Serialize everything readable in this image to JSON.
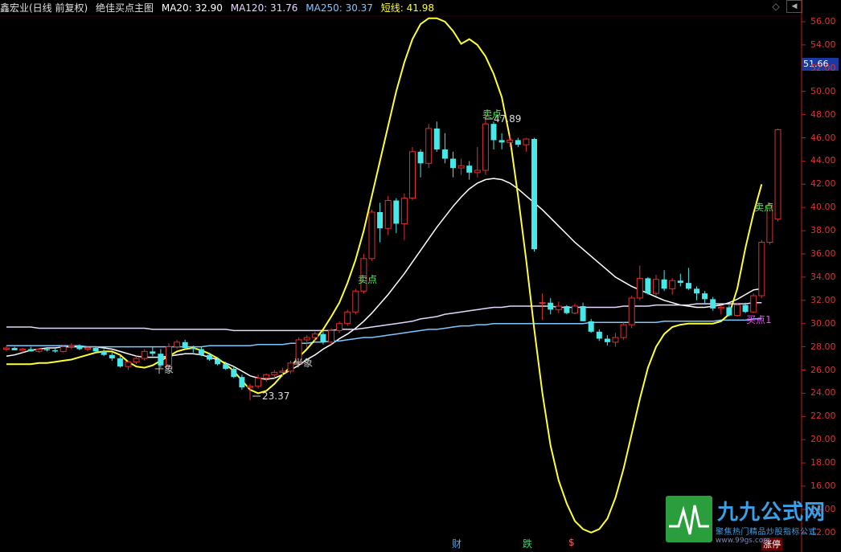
{
  "header": {
    "stock": "鑫宏业(日线 前复权)",
    "indicator": "绝佳买点主图",
    "ma20": "MA20: 32.90",
    "ma120": "MA120: 31.76",
    "ma250": "MA250: 30.37",
    "short_line": "短线: 41.98"
  },
  "price_flag": "51.66",
  "y_axis": [
    "56.00",
    "54.00",
    "52.00",
    "50.00",
    "48.00",
    "46.00",
    "44.00",
    "42.00",
    "40.00",
    "38.00",
    "36.00",
    "34.00",
    "32.00",
    "30.00",
    "28.00",
    "26.00",
    "24.00",
    "22.00",
    "20.00",
    "18.00",
    "16.00",
    "14.00",
    "12.00"
  ],
  "annotations": {
    "high_label": "47.89",
    "low_label": "23.37",
    "sell_1": "卖点",
    "sell_2": "卖点",
    "buy_1": "卖点",
    "elephant_1": "十象",
    "elephant_2": "半象",
    "buy_marker": "买点1"
  },
  "bottom_markers": {
    "cai": "财",
    "die": "跌",
    "dollar": "$",
    "zhangting": "涨停"
  },
  "logo": {
    "title": "九九公式网",
    "subtitle": "聚焦热门精品炒股指标公式",
    "url": "www.99gs.com"
  },
  "colors": {
    "up": "#e03030",
    "down": "#48e8e8",
    "ma20": "#ffffff",
    "ma120": "#e6d8ff",
    "ma250": "#7ec8ff",
    "short": "#ffff33",
    "axis": "#c02020"
  },
  "chart_data": {
    "type": "candlestick",
    "ylim": [
      12,
      57
    ],
    "candles": [
      [
        27.8,
        28.1,
        27.6,
        27.9
      ],
      [
        27.9,
        28.0,
        27.7,
        27.7
      ],
      [
        27.7,
        27.9,
        27.5,
        27.8
      ],
      [
        27.8,
        28.0,
        27.6,
        27.6
      ],
      [
        27.6,
        27.9,
        27.5,
        27.8
      ],
      [
        27.8,
        27.9,
        27.6,
        27.7
      ],
      [
        27.7,
        27.9,
        27.5,
        27.6
      ],
      [
        27.6,
        28.1,
        27.5,
        28.0
      ],
      [
        28.0,
        28.3,
        27.8,
        28.1
      ],
      [
        28.1,
        28.2,
        27.7,
        27.8
      ],
      [
        27.8,
        28.0,
        27.6,
        27.9
      ],
      [
        27.9,
        28.0,
        27.5,
        27.6
      ],
      [
        27.6,
        27.8,
        27.2,
        27.3
      ],
      [
        27.3,
        27.5,
        26.8,
        27.0
      ],
      [
        27.0,
        27.2,
        26.2,
        26.3
      ],
      [
        26.3,
        26.8,
        26.0,
        26.7
      ],
      [
        26.7,
        27.2,
        26.5,
        27.0
      ],
      [
        27.0,
        27.8,
        26.8,
        27.6
      ],
      [
        27.6,
        28.0,
        27.2,
        27.4
      ],
      [
        27.4,
        27.8,
        26.2,
        26.4
      ],
      [
        26.4,
        28.3,
        26.2,
        28.0
      ],
      [
        28.0,
        28.6,
        27.8,
        28.4
      ],
      [
        28.4,
        28.6,
        27.8,
        27.9
      ],
      [
        27.9,
        28.1,
        27.5,
        27.8
      ],
      [
        27.8,
        28.0,
        27.2,
        27.3
      ],
      [
        27.3,
        27.5,
        26.8,
        26.9
      ],
      [
        26.9,
        27.1,
        26.4,
        26.5
      ],
      [
        26.5,
        26.7,
        26.0,
        26.1
      ],
      [
        26.1,
        26.3,
        25.3,
        25.4
      ],
      [
        25.4,
        25.6,
        24.3,
        24.5
      ],
      [
        24.5,
        24.8,
        23.4,
        24.6
      ],
      [
        24.6,
        25.6,
        24.4,
        25.3
      ],
      [
        25.3,
        25.7,
        25.0,
        25.6
      ],
      [
        25.6,
        26.0,
        25.3,
        25.8
      ],
      [
        25.8,
        26.2,
        25.4,
        25.9
      ],
      [
        25.9,
        26.8,
        25.7,
        26.6
      ],
      [
        26.6,
        28.8,
        26.4,
        28.6
      ],
      [
        28.6,
        29.0,
        27.9,
        28.8
      ],
      [
        28.8,
        29.3,
        28.4,
        29.1
      ],
      [
        29.1,
        29.4,
        28.2,
        28.4
      ],
      [
        28.4,
        29.6,
        28.2,
        29.4
      ],
      [
        29.4,
        30.2,
        29.2,
        30.0
      ],
      [
        30.0,
        31.2,
        29.8,
        31.0
      ],
      [
        31.0,
        33.0,
        30.8,
        32.8
      ],
      [
        32.8,
        36.0,
        32.6,
        35.6
      ],
      [
        35.6,
        39.8,
        35.4,
        39.6
      ],
      [
        39.6,
        40.4,
        37.0,
        38.2
      ],
      [
        38.2,
        41.0,
        37.6,
        40.6
      ],
      [
        40.6,
        40.8,
        37.8,
        38.6
      ],
      [
        38.6,
        41.2,
        37.2,
        40.8
      ],
      [
        40.8,
        45.2,
        40.6,
        44.8
      ],
      [
        44.8,
        45.0,
        42.6,
        43.8
      ],
      [
        43.8,
        47.2,
        43.4,
        46.8
      ],
      [
        46.8,
        47.4,
        44.8,
        45.0
      ],
      [
        45.0,
        46.4,
        43.8,
        44.2
      ],
      [
        44.2,
        44.8,
        42.6,
        43.4
      ],
      [
        43.4,
        44.2,
        42.8,
        43.6
      ],
      [
        43.6,
        44.0,
        42.4,
        43.0
      ],
      [
        43.0,
        45.2,
        42.6,
        43.2
      ],
      [
        43.2,
        47.9,
        42.8,
        47.2
      ],
      [
        47.2,
        47.4,
        45.0,
        45.8
      ],
      [
        45.8,
        46.4,
        45.0,
        45.6
      ],
      [
        45.6,
        46.2,
        45.2,
        45.8
      ],
      [
        45.8,
        46.0,
        45.2,
        45.4
      ],
      [
        45.4,
        46.0,
        44.8,
        45.9
      ],
      [
        45.9,
        46.0,
        36.2,
        36.4
      ],
      [
        31.8,
        32.6,
        30.3,
        31.8
      ],
      [
        31.8,
        32.2,
        30.8,
        31.2
      ],
      [
        31.2,
        31.9,
        30.9,
        31.5
      ],
      [
        31.5,
        31.6,
        30.8,
        30.9
      ],
      [
        30.9,
        31.7,
        30.8,
        31.5
      ],
      [
        31.5,
        31.8,
        30.2,
        30.2
      ],
      [
        30.2,
        30.4,
        29.2,
        29.3
      ],
      [
        29.3,
        29.5,
        28.5,
        28.7
      ],
      [
        28.7,
        29.0,
        28.1,
        28.4
      ],
      [
        28.4,
        29.2,
        28.0,
        28.8
      ],
      [
        28.8,
        30.1,
        28.6,
        29.9
      ],
      [
        29.9,
        32.4,
        29.6,
        32.2
      ],
      [
        32.2,
        35.0,
        32.0,
        33.9
      ],
      [
        33.9,
        34.0,
        32.5,
        32.6
      ],
      [
        32.6,
        34.2,
        32.4,
        33.8
      ],
      [
        33.8,
        34.6,
        32.8,
        33.0
      ],
      [
        33.0,
        33.9,
        32.5,
        33.7
      ],
      [
        33.7,
        34.3,
        33.2,
        33.5
      ],
      [
        33.5,
        34.8,
        32.9,
        33.0
      ],
      [
        33.0,
        33.2,
        32.0,
        32.6
      ],
      [
        32.6,
        32.8,
        31.7,
        32.1
      ],
      [
        32.1,
        32.3,
        31.1,
        31.3
      ],
      [
        31.3,
        31.6,
        30.8,
        31.4
      ],
      [
        31.4,
        31.6,
        30.6,
        30.7
      ],
      [
        30.7,
        31.8,
        30.6,
        31.6
      ],
      [
        31.6,
        31.8,
        30.9,
        31.0
      ],
      [
        31.0,
        32.6,
        30.9,
        32.4
      ],
      [
        32.4,
        37.2,
        32.2,
        37.0
      ],
      [
        37.0,
        40.4,
        36.8,
        40.2
      ],
      [
        39.0,
        46.8,
        38.8,
        46.7
      ]
    ],
    "series": [
      {
        "name": "MA20",
        "values": [
          27.2,
          27.3,
          27.5,
          27.7,
          27.8,
          27.9,
          27.9,
          28.0,
          28.0,
          28.0,
          28.0,
          28.0,
          27.9,
          27.8,
          27.6,
          27.4,
          27.2,
          27.1,
          27.1,
          27.1,
          27.2,
          27.3,
          27.4,
          27.4,
          27.3,
          27.1,
          26.9,
          26.6,
          26.3,
          25.9,
          25.5,
          25.3,
          25.2,
          25.3,
          25.6,
          26.0,
          26.4,
          26.9,
          27.3,
          27.8,
          28.2,
          28.7,
          29.1,
          29.6,
          30.2,
          30.9,
          31.7,
          32.5,
          33.4,
          34.3,
          35.3,
          36.3,
          37.3,
          38.3,
          39.2,
          40.1,
          40.9,
          41.6,
          42.1,
          42.4,
          42.5,
          42.4,
          42.1,
          41.6,
          41.0,
          40.4,
          39.8,
          39.1,
          38.4,
          37.7,
          37.0,
          36.4,
          35.8,
          35.2,
          34.6,
          34.0,
          33.6,
          33.2,
          32.9,
          32.6,
          32.3,
          32.0,
          31.8,
          31.6,
          31.5,
          31.4,
          31.4,
          31.5,
          31.6,
          31.8,
          32.1,
          32.5,
          32.9,
          33.0
        ]
      },
      {
        "name": "MA120",
        "values": [
          29.7,
          29.7,
          29.7,
          29.7,
          29.6,
          29.6,
          29.6,
          29.6,
          29.6,
          29.6,
          29.6,
          29.6,
          29.6,
          29.6,
          29.6,
          29.6,
          29.6,
          29.6,
          29.5,
          29.5,
          29.5,
          29.5,
          29.5,
          29.5,
          29.5,
          29.5,
          29.5,
          29.5,
          29.4,
          29.4,
          29.4,
          29.4,
          29.4,
          29.4,
          29.4,
          29.4,
          29.4,
          29.4,
          29.4,
          29.4,
          29.4,
          29.5,
          29.5,
          29.5,
          29.6,
          29.7,
          29.8,
          29.9,
          30.0,
          30.1,
          30.2,
          30.4,
          30.5,
          30.6,
          30.8,
          30.9,
          31.0,
          31.1,
          31.2,
          31.3,
          31.4,
          31.4,
          31.5,
          31.5,
          31.5,
          31.5,
          31.5,
          31.5,
          31.4,
          31.4,
          31.4,
          31.4,
          31.4,
          31.4,
          31.4,
          31.4,
          31.5,
          31.5,
          31.5,
          31.5,
          31.6,
          31.6,
          31.6,
          31.6,
          31.6,
          31.7,
          31.7,
          31.7,
          31.7,
          31.7,
          31.7,
          31.7,
          31.8,
          31.8
        ]
      },
      {
        "name": "MA250",
        "values": [
          28.1,
          28.1,
          28.1,
          28.1,
          28.1,
          28.1,
          28.1,
          28.1,
          28.1,
          28.1,
          28.0,
          28.0,
          28.0,
          28.0,
          28.0,
          28.0,
          28.0,
          28.0,
          28.0,
          28.0,
          28.0,
          28.0,
          28.0,
          28.0,
          28.0,
          28.1,
          28.1,
          28.1,
          28.1,
          28.1,
          28.1,
          28.2,
          28.2,
          28.2,
          28.2,
          28.3,
          28.3,
          28.3,
          28.4,
          28.4,
          28.5,
          28.5,
          28.6,
          28.7,
          28.8,
          28.8,
          28.9,
          29.0,
          29.1,
          29.2,
          29.3,
          29.4,
          29.5,
          29.5,
          29.6,
          29.7,
          29.8,
          29.8,
          29.9,
          29.9,
          30.0,
          30.0,
          30.0,
          30.0,
          30.0,
          30.0,
          30.0,
          30.0,
          30.0,
          30.0,
          30.0,
          30.0,
          30.1,
          30.1,
          30.1,
          30.1,
          30.1,
          30.1,
          30.1,
          30.1,
          30.1,
          30.2,
          30.2,
          30.2,
          30.2,
          30.2,
          30.2,
          30.2,
          30.3,
          30.3,
          30.3,
          30.3,
          30.4,
          30.4
        ]
      },
      {
        "name": "短线",
        "values": [
          26.5,
          26.5,
          26.5,
          26.5,
          26.6,
          26.6,
          26.7,
          26.8,
          26.9,
          27.1,
          27.3,
          27.5,
          27.6,
          27.6,
          27.3,
          26.7,
          26.3,
          26.2,
          26.4,
          26.8,
          27.2,
          27.6,
          27.8,
          27.9,
          27.7,
          27.4,
          27.0,
          26.5,
          25.9,
          25.1,
          24.3,
          24.0,
          24.2,
          24.8,
          25.6,
          26.3,
          27.1,
          27.8,
          28.6,
          29.5,
          30.6,
          31.8,
          33.5,
          35.5,
          38.0,
          41.0,
          44.0,
          47.0,
          50.0,
          52.5,
          54.5,
          55.8,
          56.3,
          56.3,
          56.0,
          55.2,
          54.1,
          54.5,
          54.0,
          53.0,
          51.5,
          49.5,
          46.0,
          41.0,
          35.5,
          29.5,
          24.0,
          19.5,
          16.5,
          14.5,
          13.0,
          12.3,
          12.0,
          12.3,
          13.2,
          15.0,
          17.5,
          20.5,
          23.5,
          26.2,
          28.0,
          29.1,
          29.7,
          29.9,
          30.0,
          30.0,
          30.0,
          30.0,
          30.2,
          30.8,
          33.0,
          36.5,
          39.5,
          42.0
        ]
      }
    ]
  }
}
